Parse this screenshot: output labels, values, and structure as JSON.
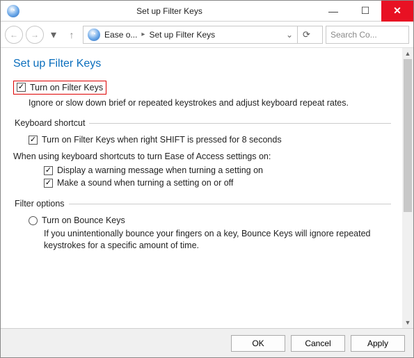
{
  "window": {
    "title": "Set up Filter Keys",
    "icon": "ease-of-access-icon"
  },
  "nav": {
    "breadcrumb": [
      "Ease o...",
      "Set up Filter Keys"
    ],
    "search_placeholder": "Search Co..."
  },
  "page": {
    "heading": "Set up Filter Keys",
    "turn_on_label": "Turn on Filter Keys",
    "turn_on_desc": "Ignore or slow down brief or repeated keystrokes and adjust keyboard repeat rates.",
    "shortcut": {
      "legend": "Keyboard shortcut",
      "enable_label": "Turn on Filter Keys when right SHIFT is pressed for 8 seconds",
      "sub_intro": "When using keyboard shortcuts to turn Ease of Access settings on:",
      "warn_label": "Display a warning message when turning a setting on",
      "sound_label": "Make a sound when turning a setting on or off"
    },
    "filter": {
      "legend": "Filter options",
      "bounce_label": "Turn on Bounce Keys",
      "bounce_desc": "If you unintentionally bounce your fingers on a key, Bounce Keys will ignore repeated keystrokes for a specific amount of time."
    }
  },
  "buttons": {
    "ok": "OK",
    "cancel": "Cancel",
    "apply": "Apply"
  }
}
